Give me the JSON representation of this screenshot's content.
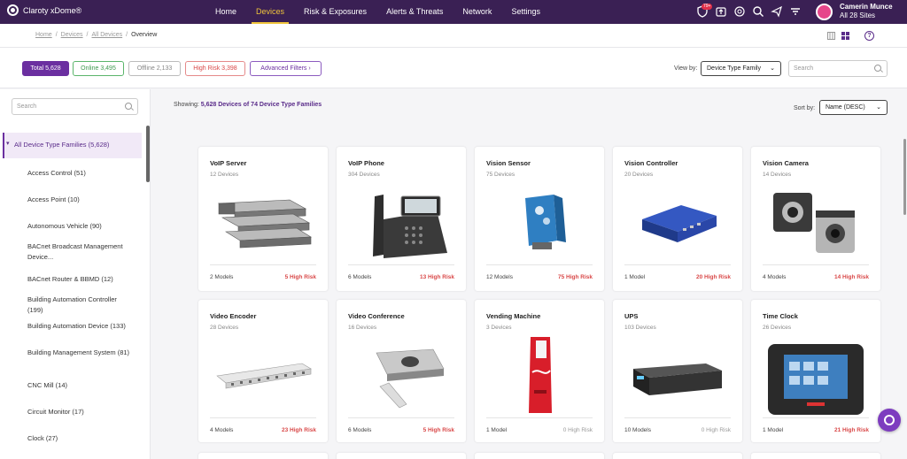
{
  "brand": {
    "name": "Claroty xDome®"
  },
  "nav": {
    "tabs": [
      "Home",
      "Devices",
      "Risk & Exposures",
      "Alerts & Threats",
      "Network",
      "Settings"
    ],
    "notification_badge": "79+"
  },
  "user": {
    "name": "Camerin Munce",
    "scope": "All 28 Sites"
  },
  "breadcrumb": {
    "home": "Home",
    "devices": "Devices",
    "all_devices": "All Devices",
    "current": "Overview"
  },
  "help": "?",
  "filters": {
    "total": "Total 5,628",
    "online": "Online 3,495",
    "offline": "Offline 2,133",
    "high_risk": "High Risk 3,398",
    "advanced": "Advanced Filters"
  },
  "view_by": {
    "label": "View by:",
    "value": "Device Type Family"
  },
  "search": {
    "placeholder": "Search"
  },
  "sidebar": {
    "search_placeholder": "Search",
    "active": "All Device Type Families (5,628)",
    "items": [
      "Access Control (51)",
      "Access Point (10)",
      "Autonomous Vehicle (90)",
      "BACnet Broadcast Management Device...",
      "BACnet Router & BBMD (12)",
      "Building Automation Controller (199)",
      "Building Automation Device (133)",
      "Building Management System (81)",
      "CNC Mill (14)",
      "Circuit Monitor (17)",
      "Clock (27)"
    ]
  },
  "showing": {
    "label": "Showing:",
    "value": "5,628 Devices of 74 Device Type Families"
  },
  "sort_by": {
    "label": "Sort by:",
    "value": "Name (DESC)"
  },
  "cards": [
    {
      "title": "VoIP Server",
      "count": "12 Devices",
      "models": "2 Models",
      "risk": "5 High Risk",
      "img": "server"
    },
    {
      "title": "VoIP Phone",
      "count": "304 Devices",
      "models": "6 Models",
      "risk": "13 High Risk",
      "img": "phone"
    },
    {
      "title": "Vision Sensor",
      "count": "75 Devices",
      "models": "12 Models",
      "risk": "75 High Risk",
      "img": "sensor"
    },
    {
      "title": "Vision Controller",
      "count": "20 Devices",
      "models": "1 Model",
      "risk": "20 High Risk",
      "img": "controller"
    },
    {
      "title": "Vision Camera",
      "count": "14 Devices",
      "models": "4 Models",
      "risk": "14 High Risk",
      "img": "camera"
    },
    {
      "title": "Video Encoder",
      "count": "28 Devices",
      "models": "4 Models",
      "risk": "23 High Risk",
      "img": "encoder"
    },
    {
      "title": "Video Conference",
      "count": "16 Devices",
      "models": "6 Models",
      "risk": "5 High Risk",
      "img": "conference"
    },
    {
      "title": "Vending Machine",
      "count": "3 Devices",
      "models": "1 Model",
      "risk": "0 High Risk",
      "img": "vending"
    },
    {
      "title": "UPS",
      "count": "103 Devices",
      "models": "10 Models",
      "risk": "0 High Risk",
      "img": "ups"
    },
    {
      "title": "Time Clock",
      "count": "26 Devices",
      "models": "1 Model",
      "risk": "21 High Risk",
      "img": "timeclock"
    }
  ]
}
